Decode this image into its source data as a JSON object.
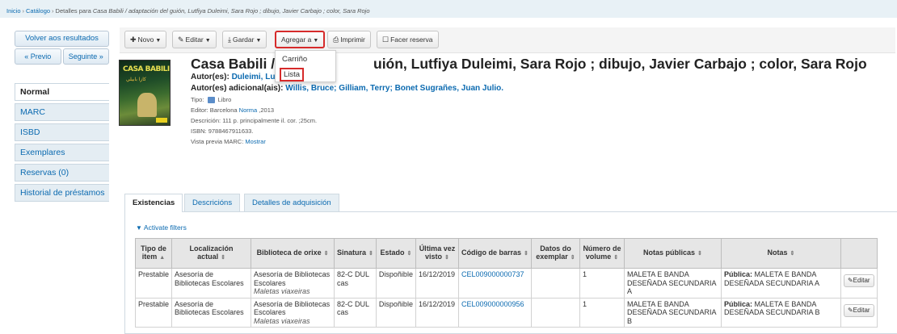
{
  "breadcrumb": {
    "home": "Inicio",
    "catalog": "Catálogo",
    "current_prefix": "Detalles para ",
    "current_title": "Casa Babili / adaptación del guión, Lutfiya Duleimi, Sara Rojo ; dibujo, Javier Carbajo ; color, Sara Rojo"
  },
  "left": {
    "back": "Volver aos resultados",
    "prev": "« Previo",
    "next": "Seguinte »",
    "views": [
      "Normal",
      "MARC",
      "ISBD",
      "Exemplares",
      "Reservas (0)",
      "Historial de préstamos"
    ]
  },
  "toolbar": {
    "new": "Novo",
    "edit": "Editar",
    "save": "Gardar",
    "add_to": "Agregar a",
    "print": "Imprimir",
    "hold": "Facer reserva"
  },
  "add_menu": {
    "cart": "Carriño",
    "list": "Lista"
  },
  "record": {
    "title_start": "Casa Babili / a",
    "title_end": "uión, Lutfiya Duleimi, Sara Rojo ; dibujo, Javier Carbajo ; color, Sara Rojo",
    "authors_label": "Autor(es):",
    "authors_value": "Duleimi, Lut",
    "added_authors_label": "Autor(es) adicional(ais):",
    "added_authors_value": "Willis, Bruce; Gilliam, Terry; Bonet Sugrañes, Juan Julio.",
    "type_label": "Tipo:",
    "type_value": "Libro",
    "publisher_label": "Editor:",
    "publisher_place": "Barcelona",
    "publisher_name": "Norma",
    "publisher_year": ",2013",
    "description_label": "Descrición:",
    "description_value": "111 p. principalmente il. cor. ;25cm.",
    "isbn_label": "ISBN:",
    "isbn_value": "9788467911633.",
    "marc_label": "Vista previa MARC:",
    "marc_link": "Mostrar"
  },
  "cover": {
    "text1": "CASA BABILI",
    "text2": "كازا بابيلي"
  },
  "tabs": [
    "Existencias",
    "Descricións",
    "Detalles de adquisición"
  ],
  "filters": "Activate filters",
  "table": {
    "headers": [
      "Tipo de item",
      "Localización actual",
      "Biblioteca de orixe",
      "Sinatura",
      "Estado",
      "Última vez visto",
      "Código de barras",
      "Datos do exemplar",
      "Número de volume",
      "Notas públicas",
      "Notas",
      ""
    ],
    "rows": [
      {
        "type": "Prestable",
        "location": "Asesoría de Bibliotecas Escolares",
        "home": "Asesoría de Bibliotecas Escolares",
        "home_sub": "Maletas viaxeiras",
        "callnumber": "82-C DUL cas",
        "status": "Dispoñible",
        "lastseen": "16/12/2019",
        "barcode": "CEL009000000737",
        "enum": "",
        "volume": "1",
        "public_note": "MALETA E BANDA DESEÑADA SECUNDARIA A",
        "note_label": "Pública:",
        "note_value": "MALETA E BANDA DESEÑADA SECUNDARIA A",
        "edit": "Editar"
      },
      {
        "type": "Prestable",
        "location": "Asesoría de Bibliotecas Escolares",
        "home": "Asesoría de Bibliotecas Escolares",
        "home_sub": "Maletas viaxeiras",
        "callnumber": "82-C DUL cas",
        "status": "Dispoñible",
        "lastseen": "16/12/2019",
        "barcode": "CEL009000000956",
        "enum": "",
        "volume": "1",
        "public_note": "MALETA E BANDA DESEÑADA SECUNDARIA B",
        "note_label": "Pública:",
        "note_value": "MALETA E BANDA DESEÑADA SECUNDARIA B",
        "edit": "Editar"
      }
    ]
  },
  "colors": {
    "link": "#0b6ab0",
    "highlight": "#d62a2a",
    "breadcrumb_bg": "#e8f1f6"
  }
}
